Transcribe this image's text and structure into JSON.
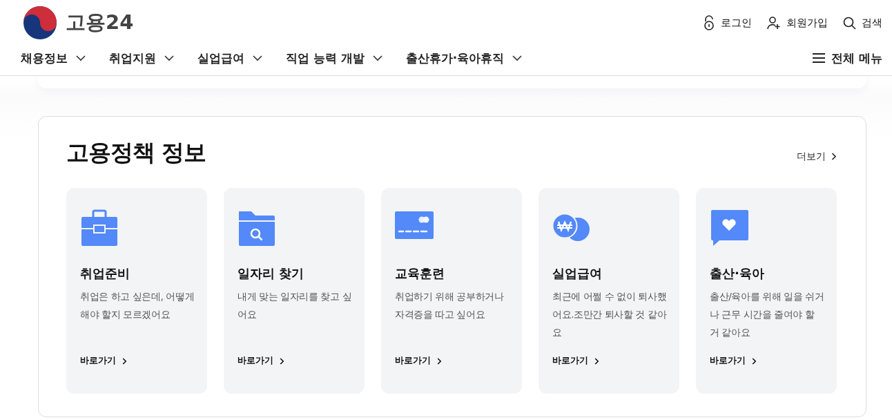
{
  "header": {
    "logo_text": "고용24",
    "utility_links": [
      {
        "kind": "login",
        "label": "로그인"
      },
      {
        "kind": "signup",
        "label": "회원가입"
      },
      {
        "kind": "search",
        "label": "검색"
      }
    ]
  },
  "nav": {
    "items": [
      "채용정보",
      "취업지원",
      "실업급여",
      "직업 능력 개발",
      "출산휴가·육아휴직"
    ],
    "all_menu": "전체 메뉴"
  },
  "section": {
    "title": "고용정책 정보",
    "more": "더보기",
    "cards": [
      {
        "title": "취업준비",
        "description": "취업은 하고 싶은데, 어떻게 해야 할지 모르겠어요",
        "link": "바로가기"
      },
      {
        "title": "일자리 찾기",
        "description": "내게 맞는 일자리를 찾고 싶어요",
        "link": "바로가기"
      },
      {
        "title": "교육훈련",
        "description": "취업하기 위해 공부하거나 자격증을 따고 싶어요",
        "link": "바로가기"
      },
      {
        "title": "실업급여",
        "description": "최근에 어쩔 수 없이 퇴사했어요.조만간 퇴사할 것 같아요",
        "link": "바로가기"
      },
      {
        "title": "출산·육아",
        "description": "출산/육아를 위해 일을 쉬거나 근무 시간을 줄여야 할 거 같아요",
        "link": "바로가기"
      }
    ]
  }
}
